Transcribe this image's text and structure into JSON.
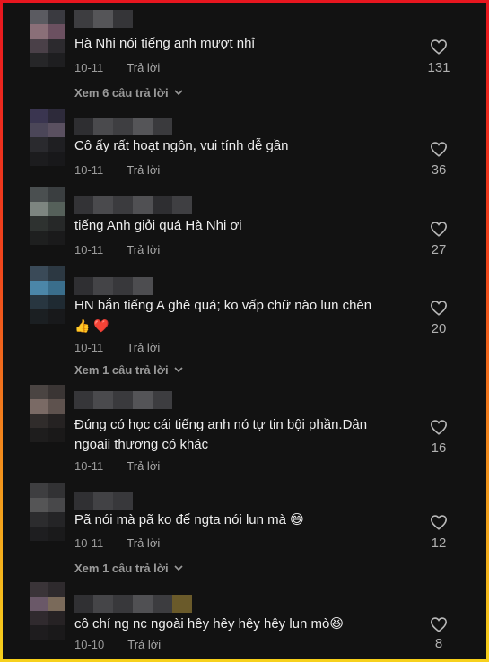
{
  "comments": [
    {
      "text": "Hà Nhi nói tiếng anh mượt nhỉ",
      "date": "10-11",
      "reply": "Trả lời",
      "likes": "131",
      "more": "Xem 6 câu trả lời"
    },
    {
      "text": "Cô ấy rất hoạt ngôn, vui tính dễ gần",
      "date": "10-11",
      "reply": "Trả lời",
      "likes": "36"
    },
    {
      "text": "tiếng Anh giỏi quá Hà Nhi ơi",
      "date": "10-11",
      "reply": "Trả lời",
      "likes": "27"
    },
    {
      "text": "HN bắn tiếng A ghê quá; ko vấp chữ nào lun chèn",
      "emoji": "👍 ❤️",
      "date": "10-11",
      "reply": "Trả lời",
      "likes": "20",
      "more": "Xem 1 câu trả lời"
    },
    {
      "text": "Đúng có học cái tiếng anh nó tự tin bội phần.Dân ngoaii thương có khác",
      "date": "10-11",
      "reply": "Trả lời",
      "likes": "16"
    },
    {
      "text": "Pã nói mà pã ko để ngta nói lun mà 😄",
      "date": "10-11",
      "reply": "Trả lời",
      "likes": "12",
      "more": "Xem 1 câu trả lời"
    },
    {
      "text": "cô chí ng nc ngoài hêy hêy hêy hêy lun mò😆",
      "date": "10-10",
      "reply": "Trả lời",
      "likes": "8"
    }
  ],
  "icons": {
    "like": "heart-outline-icon",
    "expand": "chevron-down-icon"
  },
  "colors": {
    "background": "#121212",
    "text": "#eeeeee",
    "muted": "#9a9a9a"
  }
}
